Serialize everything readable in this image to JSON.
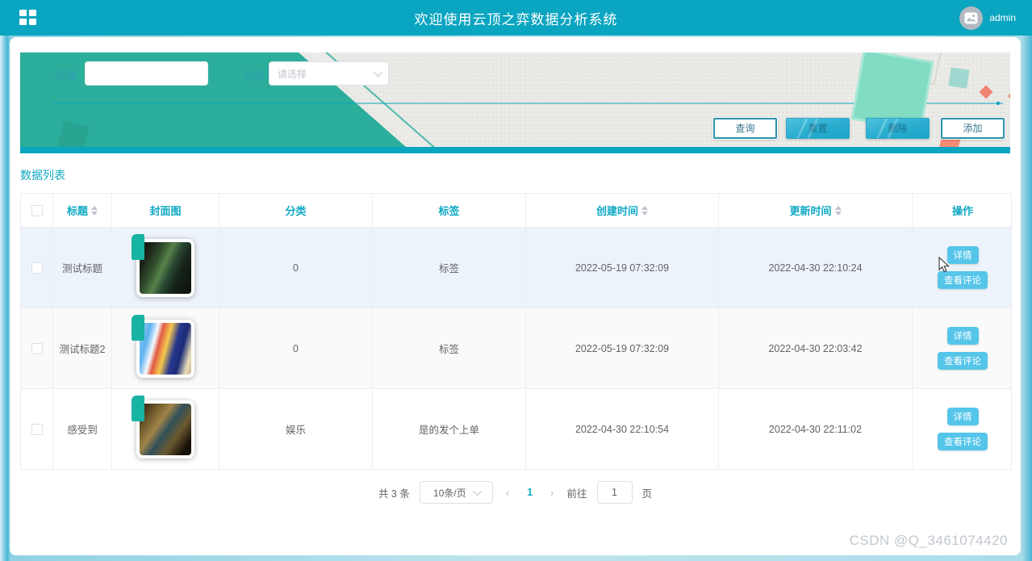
{
  "header": {
    "title": "欢迎使用云顶之弈数据分析系统",
    "username": "admin"
  },
  "search": {
    "title_label": "标题",
    "title_value": "",
    "category_label": "分类",
    "category_placeholder": "请选择",
    "buttons": {
      "query": "查询",
      "reset": "重置",
      "delete": "删除",
      "add": "添加"
    }
  },
  "list": {
    "section_title": "数据列表",
    "columns": [
      "标题",
      "封面图",
      "分类",
      "标签",
      "创建时间",
      "更新时间",
      "操作"
    ],
    "rows": [
      {
        "title": "测试标题",
        "cover": "dark-green-game-art",
        "category": "0",
        "tag": "标签",
        "created": "2022-05-19 07:32:09",
        "updated": "2022-04-30 22:10:24"
      },
      {
        "title": "测试标题2",
        "cover": "mario-colorful-game-art",
        "category": "0",
        "tag": "标签",
        "created": "2022-05-19 07:32:09",
        "updated": "2022-04-30 22:03:42"
      },
      {
        "title": "感受到",
        "cover": "dark-fantasy-game-art",
        "category": "娱乐",
        "tag": "是的发个上单",
        "created": "2022-04-30 22:10:54",
        "updated": "2022-04-30 22:11:02"
      }
    ],
    "row_actions": {
      "detail": "详情",
      "comments": "查看评论"
    }
  },
  "pagination": {
    "total_text": "共 3 条",
    "page_size": "10条/页",
    "prev_glyph": "‹",
    "next_glyph": "›",
    "current_page": "1",
    "goto_label": "前往",
    "goto_value": "1",
    "page_suffix": "页"
  },
  "watermark": "CSDN @Q_3461074420",
  "icons": {
    "menu": "grid-icon",
    "avatar": "photo-icon",
    "select_arrow": "chevron-down-icon",
    "sort": "sort-caret-icon"
  },
  "colors": {
    "header_teal": "#0aa5c0",
    "accent_teal": "#0fa9c4",
    "banner_green": "#2bae9b",
    "mint": "#82dcc4",
    "coral": "#ef8270",
    "action_button_cyan": "#55c5e9"
  }
}
